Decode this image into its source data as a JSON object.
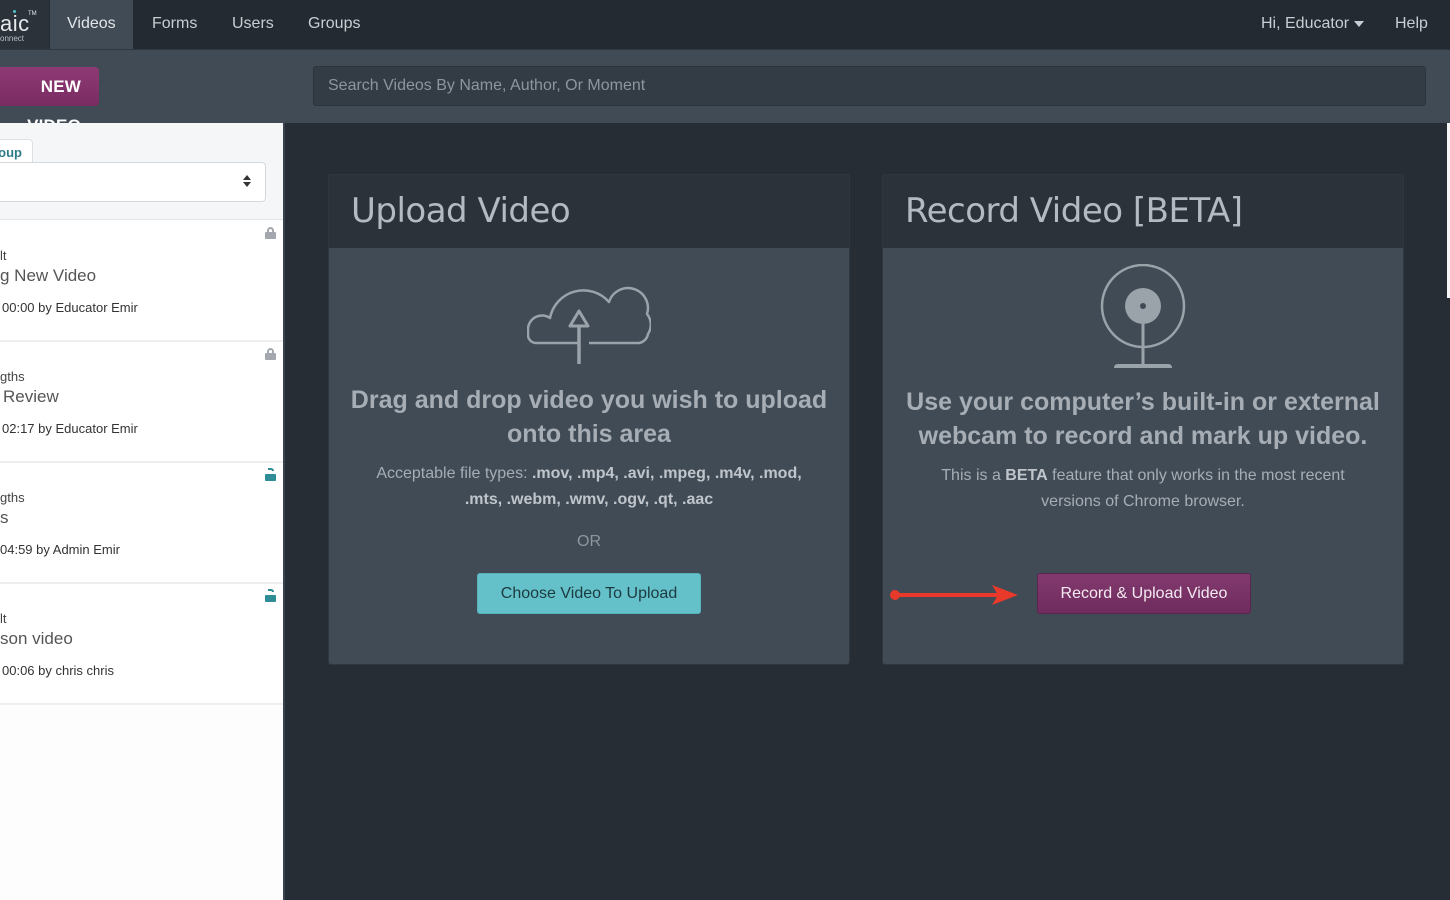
{
  "nav": {
    "logo_text": "aic",
    "logo_sub": "onnect",
    "logo_tm": "TM",
    "tabs": [
      {
        "label": "Videos",
        "active": true
      },
      {
        "label": "Forms",
        "active": false
      },
      {
        "label": "Users",
        "active": false
      },
      {
        "label": "Groups",
        "active": false
      }
    ],
    "user_menu": "Hi, Educator",
    "help": "Help"
  },
  "subbar": {
    "new_video_label": "NEW VIDEO",
    "search_placeholder": "Search Videos By Name, Author, Or Moment"
  },
  "sidebar": {
    "tab_label": "oup",
    "select_value": "",
    "videos": [
      {
        "group": "lt",
        "title": "g New Video",
        "meta": "00:00 by Educator Emir",
        "lock": "closed"
      },
      {
        "group": "gths",
        "title": "Review",
        "meta": "02:17 by Educator Emir",
        "lock": "closed"
      },
      {
        "group": "gths",
        "title": "s",
        "meta": "04:59 by Admin Emir",
        "lock": "open"
      },
      {
        "group": "lt",
        "title": "son video",
        "meta": "00:06 by chris chris",
        "lock": "open"
      }
    ]
  },
  "upload_panel": {
    "title": "Upload Video",
    "icon": "cloud-upload-icon",
    "heading": "Drag and drop video you wish to upload onto this area",
    "file_types_label": "Acceptable file types: ",
    "file_types": ".mov, .mp4, .avi, .mpeg, .m4v, .mod, .mts, .webm, .wmv, .ogv, .qt, .aac",
    "or": "OR",
    "button": "Choose Video To Upload"
  },
  "record_panel": {
    "title": "Record Video [BETA]",
    "icon": "webcam-icon",
    "heading": "Use your computer’s built-in or external webcam to record and mark up video.",
    "note_prefix": "This is a ",
    "note_bold": "BETA",
    "note_suffix": " feature that only works in the most recent versions of Chrome browser.",
    "button": "Record & Upload Video"
  },
  "annotation": {
    "type": "arrow",
    "color": "#e8392a",
    "points_to": "record-upload-button"
  },
  "colors": {
    "nav_bg": "#232a32",
    "accent_teal": "#64c1c9",
    "accent_purple": "#7a2c62",
    "panel_bg": "#414b56"
  }
}
